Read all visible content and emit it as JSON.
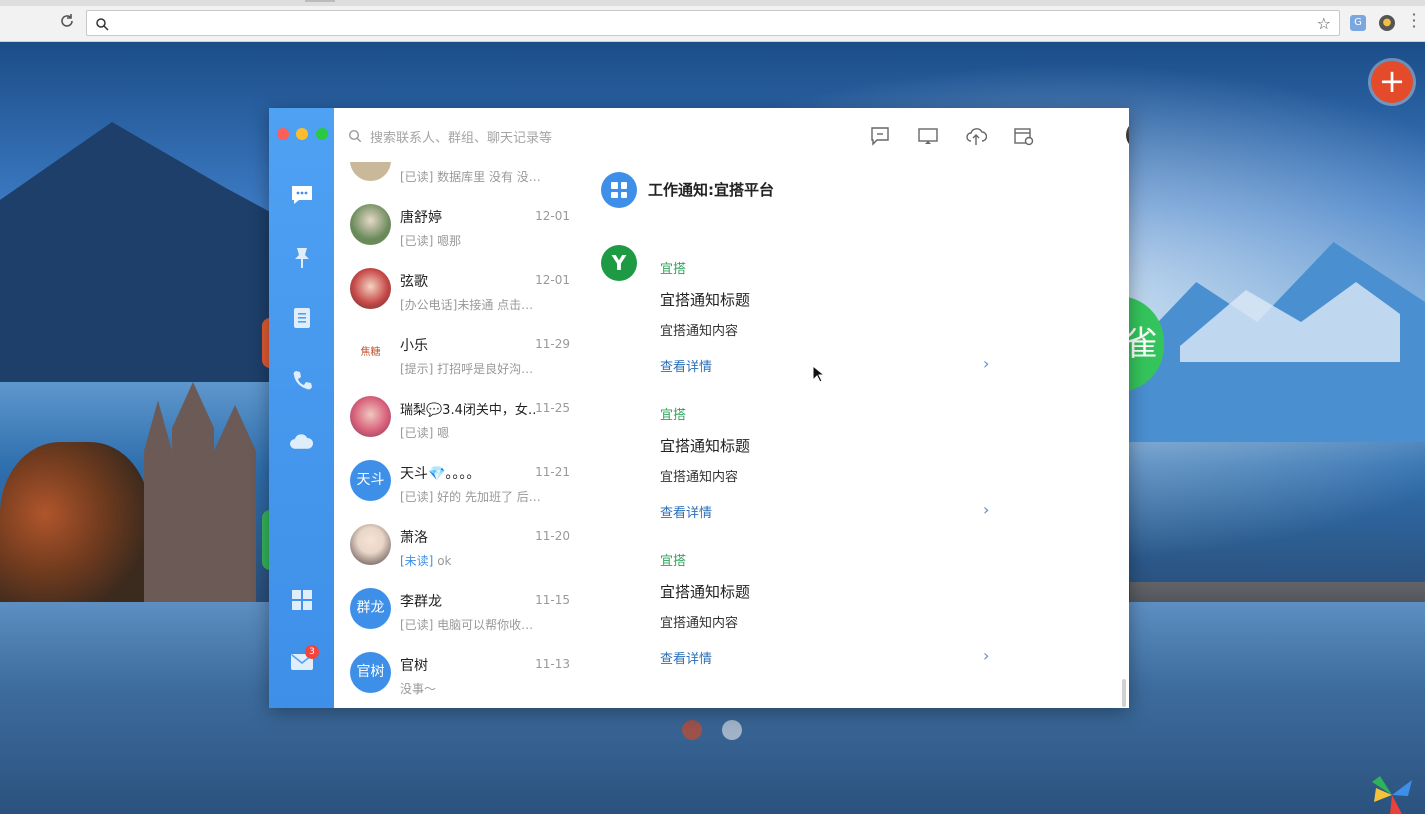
{
  "browser": {
    "reload_icon": "reload-icon",
    "address_value": "",
    "star_icon": "star-icon"
  },
  "desktop": {
    "fab_symbol": "+",
    "green_circle_text": "雀"
  },
  "app": {
    "search": {
      "placeholder": "搜索联系人、群组、聊天记录等"
    },
    "rail_icons": [
      "message-icon",
      "pin-icon",
      "contacts-icon",
      "phone-icon",
      "cloud-icon",
      "apps-icon",
      "mail-icon"
    ],
    "mail_badge": "3",
    "conversations": [
      {
        "name": "",
        "date": "",
        "preview": "[已读] 数据库里 没有 没…",
        "avatar_text": "",
        "avatar_color": "#c9b89a"
      },
      {
        "name": "唐舒婷",
        "date": "12-01",
        "preview": "[已读] 嗯那",
        "avatar_text": "",
        "avatar_color": "#6a8a5a"
      },
      {
        "name": "弦歌",
        "date": "12-01",
        "preview": "[办公电话]未接通  点击…",
        "avatar_text": "",
        "avatar_color": "#c74a4a"
      },
      {
        "name": "小乐",
        "date": "11-29",
        "preview": "[提示] 打招呼是良好沟…",
        "avatar_text": "焦糖",
        "avatar_color": "#ffffff"
      },
      {
        "name": "瑞梨💬3.4闭关中，女…",
        "date": "11-25",
        "preview": "[已读] 嗯",
        "avatar_text": "",
        "avatar_color": "#d8607a"
      },
      {
        "name": "天斗💎。。。。",
        "date": "11-21",
        "preview": "[已读] 好的 先加班了 后…",
        "avatar_text": "天斗",
        "avatar_color": "#3e8fe8"
      },
      {
        "name": "萧洛",
        "date": "11-20",
        "preview_unread": "[未读]",
        "preview": " ok",
        "avatar_text": "",
        "avatar_color": "#e8d6c8"
      },
      {
        "name": "李群龙",
        "date": "11-15",
        "preview": "[已读] 电脑可以帮你收…",
        "avatar_text": "群龙",
        "avatar_color": "#3e8fe8"
      },
      {
        "name": "官树",
        "date": "11-13",
        "preview": "没事～",
        "avatar_text": "官树",
        "avatar_color": "#3e8fe8"
      }
    ],
    "chat": {
      "title": "工作通知:宜搭平台",
      "sender_avatar": "Y",
      "messages": [
        {
          "sender": "宜搭",
          "title": "宜搭通知标题",
          "body": "宜搭通知内容",
          "link": "查看详情"
        },
        {
          "sender": "宜搭",
          "title": "宜搭通知标题",
          "body": "宜搭通知内容",
          "link": "查看详情"
        },
        {
          "sender": "宜搭",
          "title": "宜搭通知标题",
          "body": "宜搭通知内容",
          "link": "查看详情"
        }
      ]
    },
    "colors": {
      "rail": "#3e8fe8",
      "accent_green": "#30a35a",
      "link": "#2a6fb8"
    }
  }
}
